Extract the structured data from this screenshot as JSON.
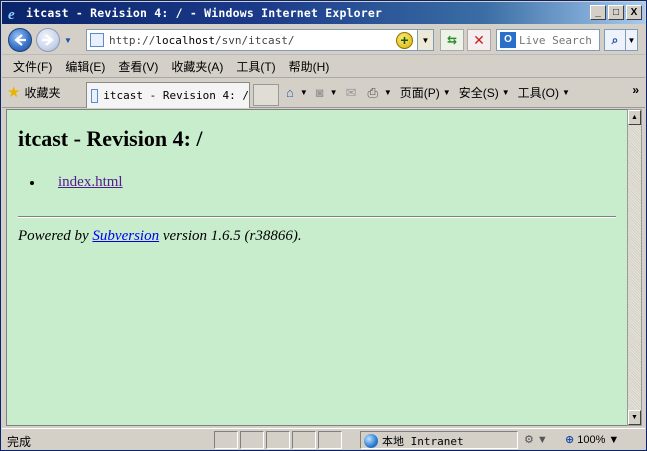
{
  "window": {
    "title": "itcast - Revision 4: / - Windows Internet Explorer",
    "minimize": "_",
    "maximize": "□",
    "close": "X"
  },
  "address_bar": {
    "url_prefix": "http://",
    "url_host": "localhost",
    "url_path": "/svn/itcast/"
  },
  "search": {
    "placeholder": "Live Search",
    "provider_icon": "O"
  },
  "menu": [
    "文件(F)",
    "编辑(E)",
    "查看(V)",
    "收藏夹(A)",
    "工具(T)",
    "帮助(H)"
  ],
  "command_bar": {
    "favorites_label": "收藏夹",
    "tab_title": "itcast - Revision 4: /",
    "page_label": "页面(P)",
    "safety_label": "安全(S)",
    "tools_label": "工具(O)",
    "more": "»"
  },
  "page": {
    "heading": "itcast - Revision 4: /",
    "files": [
      "index.html"
    ],
    "footer_prefix": "Powered by ",
    "footer_link": "Subversion",
    "footer_suffix": " version 1.6.5 (r38866)."
  },
  "status_bar": {
    "status_text": "完成",
    "zone_text": "本地 Intranet",
    "zoom": "100%"
  },
  "colors": {
    "page_background": "#c7edcc",
    "titlebar": "#0a246a",
    "visited_link": "#551a8b",
    "link": "#0000ee"
  },
  "icons": [
    "ie-app-icon",
    "back-icon",
    "forward-icon",
    "page-icon",
    "go-icon",
    "refresh-icon",
    "stop-icon",
    "live-search-icon",
    "search-icon",
    "star-icon",
    "home-icon",
    "rss-icon",
    "mail-icon",
    "print-icon",
    "globe-icon",
    "zoom-icon"
  ]
}
